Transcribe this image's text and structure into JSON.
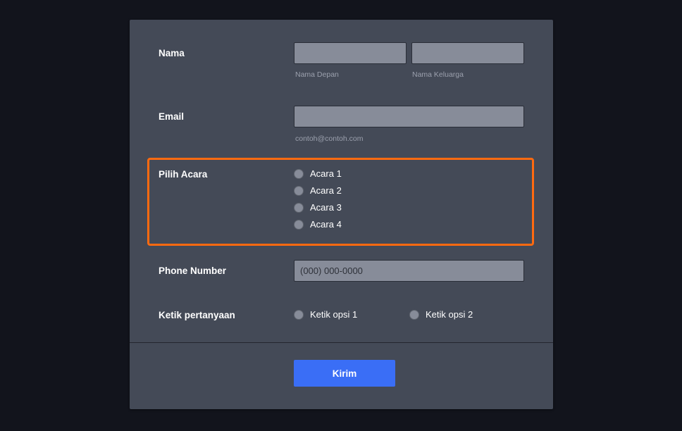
{
  "colors": {
    "page_background": "#12141c",
    "card_background": "#444a57",
    "input_background": "#878c99",
    "highlight_border": "#ff6a10",
    "submit_background": "#3a6ef6"
  },
  "form": {
    "name_field": {
      "label": "Nama",
      "first_name": {
        "value": "",
        "sublabel": "Nama Depan"
      },
      "last_name": {
        "value": "",
        "sublabel": "Nama Keluarga"
      }
    },
    "email_field": {
      "label": "Email",
      "value": "",
      "sublabel": "contoh@contoh.com"
    },
    "event_field": {
      "label": "Pilih Acara",
      "options": [
        {
          "label": "Acara 1",
          "selected": false
        },
        {
          "label": "Acara 2",
          "selected": false
        },
        {
          "label": "Acara 3",
          "selected": false
        },
        {
          "label": "Acara 4",
          "selected": false
        }
      ]
    },
    "phone_field": {
      "label": "Phone Number",
      "value": "",
      "placeholder": "(000) 000-0000"
    },
    "question_field": {
      "label": "Ketik pertanyaan",
      "options": [
        {
          "label": "Ketik opsi 1",
          "selected": false
        },
        {
          "label": "Ketik opsi 2",
          "selected": false
        }
      ]
    },
    "submit_label": "Kirim"
  }
}
